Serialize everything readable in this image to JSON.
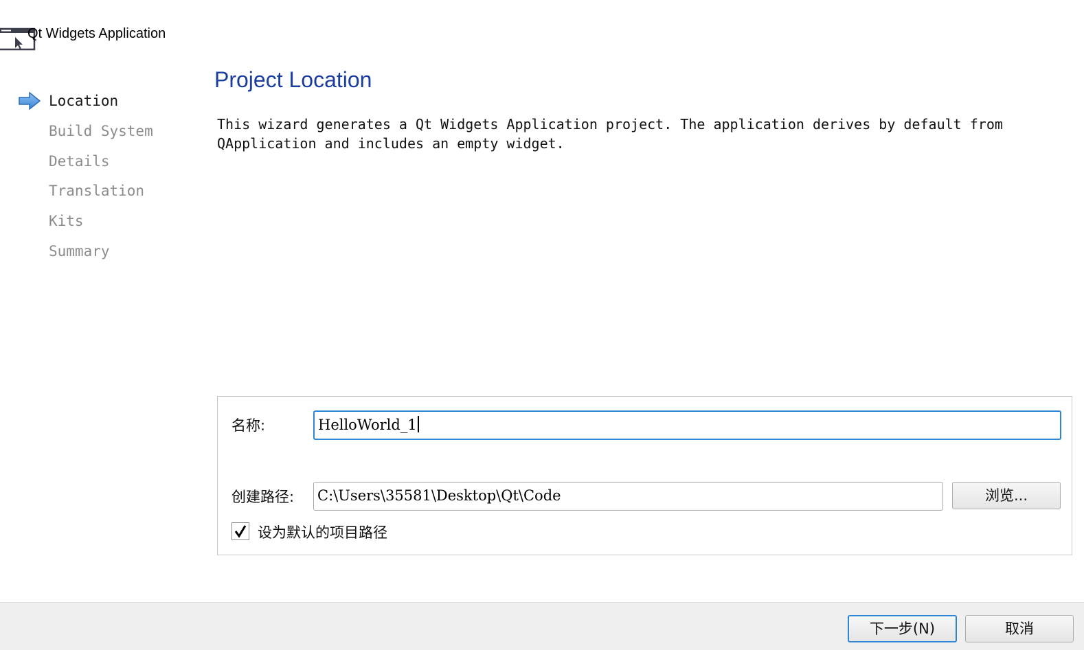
{
  "window": {
    "title": "Qt Widgets Application",
    "icon": "qt-window-icon"
  },
  "sidebar": {
    "steps": [
      {
        "label": "Location",
        "active": true
      },
      {
        "label": "Build System",
        "active": false
      },
      {
        "label": "Details",
        "active": false
      },
      {
        "label": "Translation",
        "active": false
      },
      {
        "label": "Kits",
        "active": false
      },
      {
        "label": "Summary",
        "active": false
      }
    ],
    "active_icon": "right-arrow-icon"
  },
  "main": {
    "heading": "Project Location",
    "description": "This wizard generates a Qt Widgets Application project. The application derives by default from QApplication and includes an empty widget."
  },
  "form": {
    "name_label": "名称:",
    "name_value": "HelloWorld_1",
    "path_label": "创建路径:",
    "path_value": "C:\\Users\\35581\\Desktop\\Qt\\Code",
    "browse_label": "浏览...",
    "default_path_checkbox": {
      "label": "设为默认的项目路径",
      "checked": true
    }
  },
  "footer": {
    "next_label": "下一步(N)",
    "cancel_label": "取消"
  },
  "colors": {
    "heading": "#1a3d9e",
    "focus_border": "#2e86d8",
    "inactive_step": "#8c8c8c",
    "footer_bg": "#f0f0f0"
  }
}
